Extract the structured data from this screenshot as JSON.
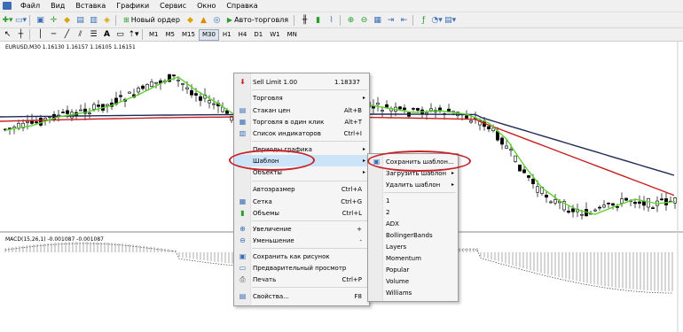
{
  "menu": [
    "Файл",
    "Вид",
    "Вставка",
    "Графики",
    "Сервис",
    "Окно",
    "Справка"
  ],
  "toolbar": {
    "new_order": "Новый ордер",
    "auto_trading": "Авто-торговля",
    "timeframes": [
      "M1",
      "M5",
      "M15",
      "M30",
      "H1",
      "H4",
      "D1",
      "W1",
      "MN"
    ],
    "active_timeframe": "M30"
  },
  "chart": {
    "header": "EURUSD,M30  1.16130 1.16157 1.16105 1.16151",
    "macd_label": "MACD(15,26,1) -0.001087 -0.001087"
  },
  "context_menu": {
    "sell_limit": {
      "label": "Sell Limit 1.00",
      "value": "1.18337"
    },
    "items": [
      {
        "label": "Торговля",
        "shortcut": "",
        "arrow": true,
        "icon": ""
      },
      {
        "label": "Стакан цен",
        "shortcut": "Alt+B",
        "arrow": false,
        "icon": "depth-icon"
      },
      {
        "label": "Торговля в один клик",
        "shortcut": "Alt+T",
        "arrow": false,
        "icon": "one-click-icon"
      },
      {
        "label": "Список индикаторов",
        "shortcut": "Ctrl+I",
        "arrow": false,
        "icon": "indicators-icon"
      },
      {
        "label": "Периоды графика",
        "shortcut": "",
        "arrow": true,
        "icon": ""
      },
      {
        "label": "Шаблон",
        "shortcut": "",
        "arrow": true,
        "icon": ""
      },
      {
        "label": "Объекты",
        "shortcut": "",
        "arrow": true,
        "icon": ""
      },
      {
        "label": "Автоэразмер",
        "shortcut": "Ctrl+A",
        "arrow": false,
        "icon": ""
      },
      {
        "label": "Сетка",
        "shortcut": "Ctrl+G",
        "arrow": false,
        "icon": "grid-icon"
      },
      {
        "label": "Объемы",
        "shortcut": "Ctrl+L",
        "arrow": false,
        "icon": "volumes-icon"
      },
      {
        "label": "Увеличение",
        "shortcut": "+",
        "arrow": false,
        "icon": "zoom-in-icon"
      },
      {
        "label": "Уменьшение",
        "shortcut": "-",
        "arrow": false,
        "icon": "zoom-out-icon"
      },
      {
        "label": "Сохранить как рисунок",
        "shortcut": "",
        "arrow": false,
        "icon": "save-picture-icon"
      },
      {
        "label": "Предварительный просмотр",
        "shortcut": "",
        "arrow": false,
        "icon": "preview-icon"
      },
      {
        "label": "Печать",
        "shortcut": "Ctrl+P",
        "arrow": false,
        "icon": "print-icon"
      },
      {
        "label": "Свойства...",
        "shortcut": "F8",
        "arrow": false,
        "icon": "properties-icon"
      }
    ]
  },
  "submenu": {
    "items": [
      "Сохранить шаблон...",
      "Загрузить шаблон",
      "Удалить шаблон",
      "1",
      "2",
      "ADX",
      "BollingerBands",
      "Layers",
      "Momentum",
      "Popular",
      "Volume",
      "Williams"
    ]
  },
  "colors": {
    "accent": "#c6222a",
    "highlight": "#cde3f7",
    "ma_green": "#5fd12f",
    "ma_red": "#c81f1f",
    "ma_navy": "#1f2a55"
  }
}
